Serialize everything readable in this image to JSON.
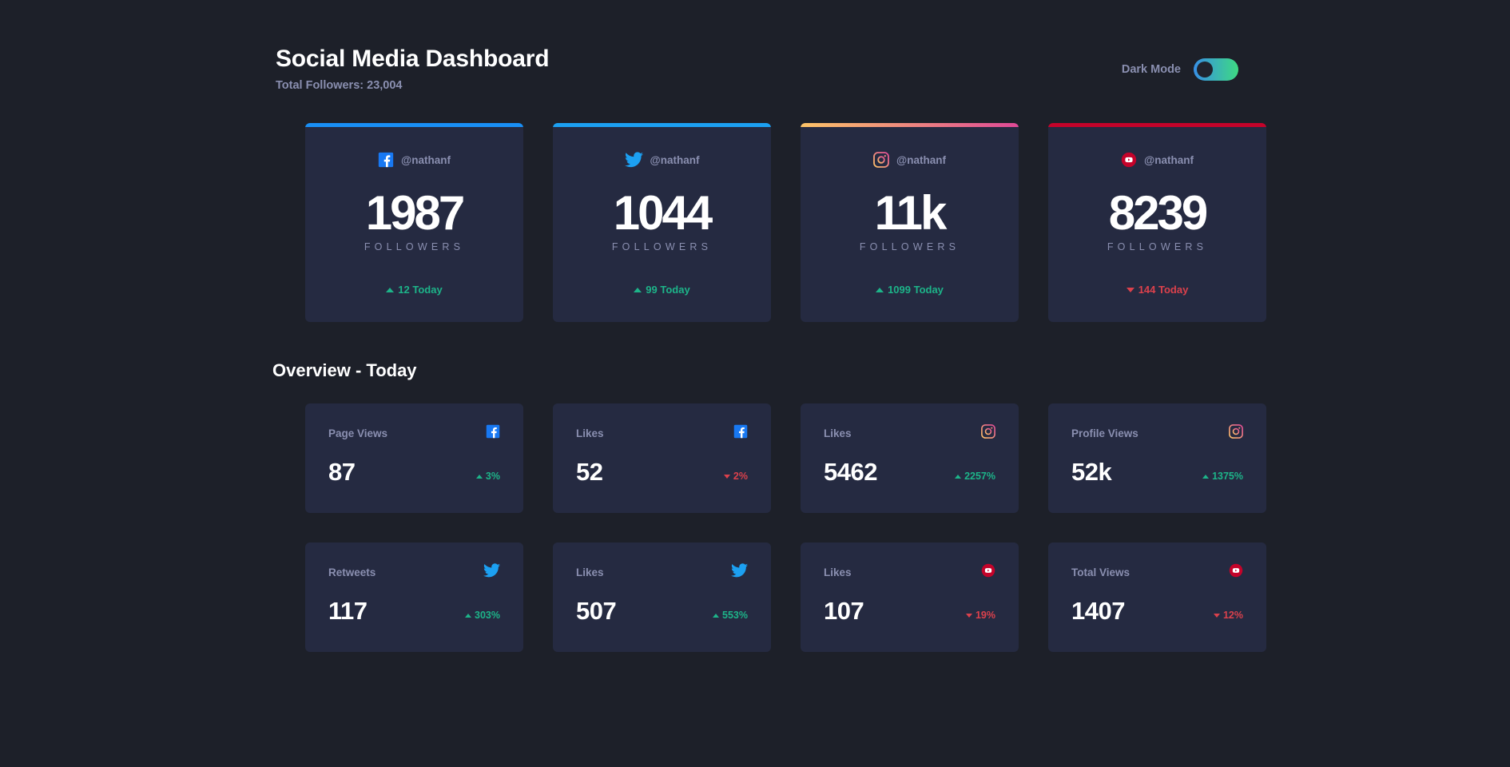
{
  "header": {
    "title": "Social Media Dashboard",
    "subtitle": "Total Followers: 23,004",
    "dark_mode_label": "Dark Mode",
    "dark_mode_on": true,
    "toggle_gradient": [
      "#378fe6",
      "#3eda82"
    ]
  },
  "colors": {
    "page_bg": "#1d2029",
    "card_bg": "#252a41",
    "text_primary": "#ffffff",
    "text_muted": "#8a8fb0",
    "up": "#1db489",
    "down": "#dc414c",
    "facebook": "#198ff5",
    "twitter": "#1ca0f2",
    "youtube": "#c4032a",
    "instagram_from": "#fdc468",
    "instagram_to": "#df4996"
  },
  "followers_label": "FOLLOWERS",
  "stat_cards": [
    {
      "platform": "facebook",
      "icon": "facebook-icon",
      "handle": "@nathanf",
      "count": "1987",
      "label": "FOLLOWERS",
      "delta": "12 Today",
      "direction": "up"
    },
    {
      "platform": "twitter",
      "icon": "twitter-icon",
      "handle": "@nathanf",
      "count": "1044",
      "label": "FOLLOWERS",
      "delta": "99 Today",
      "direction": "up"
    },
    {
      "platform": "instagram",
      "icon": "instagram-icon",
      "handle": "@nathanf",
      "count": "11k",
      "label": "FOLLOWERS",
      "delta": "1099 Today",
      "direction": "up"
    },
    {
      "platform": "youtube",
      "icon": "youtube-icon",
      "handle": "@nathanf",
      "count": "8239",
      "label": "FOLLOWERS",
      "delta": "144 Today",
      "direction": "down"
    }
  ],
  "overview": {
    "title": "Overview - Today",
    "cards": [
      {
        "label": "Page Views",
        "value": "87",
        "delta": "3%",
        "direction": "up",
        "platform": "facebook",
        "icon": "facebook-icon"
      },
      {
        "label": "Likes",
        "value": "52",
        "delta": "2%",
        "direction": "down",
        "platform": "facebook",
        "icon": "facebook-icon"
      },
      {
        "label": "Likes",
        "value": "5462",
        "delta": "2257%",
        "direction": "up",
        "platform": "instagram",
        "icon": "instagram-icon"
      },
      {
        "label": "Profile Views",
        "value": "52k",
        "delta": "1375%",
        "direction": "up",
        "platform": "instagram",
        "icon": "instagram-icon"
      },
      {
        "label": "Retweets",
        "value": "117",
        "delta": "303%",
        "direction": "up",
        "platform": "twitter",
        "icon": "twitter-icon"
      },
      {
        "label": "Likes",
        "value": "507",
        "delta": "553%",
        "direction": "up",
        "platform": "twitter",
        "icon": "twitter-icon"
      },
      {
        "label": "Likes",
        "value": "107",
        "delta": "19%",
        "direction": "down",
        "platform": "youtube",
        "icon": "youtube-icon"
      },
      {
        "label": "Total Views",
        "value": "1407",
        "delta": "12%",
        "direction": "down",
        "platform": "youtube",
        "icon": "youtube-icon"
      }
    ]
  }
}
